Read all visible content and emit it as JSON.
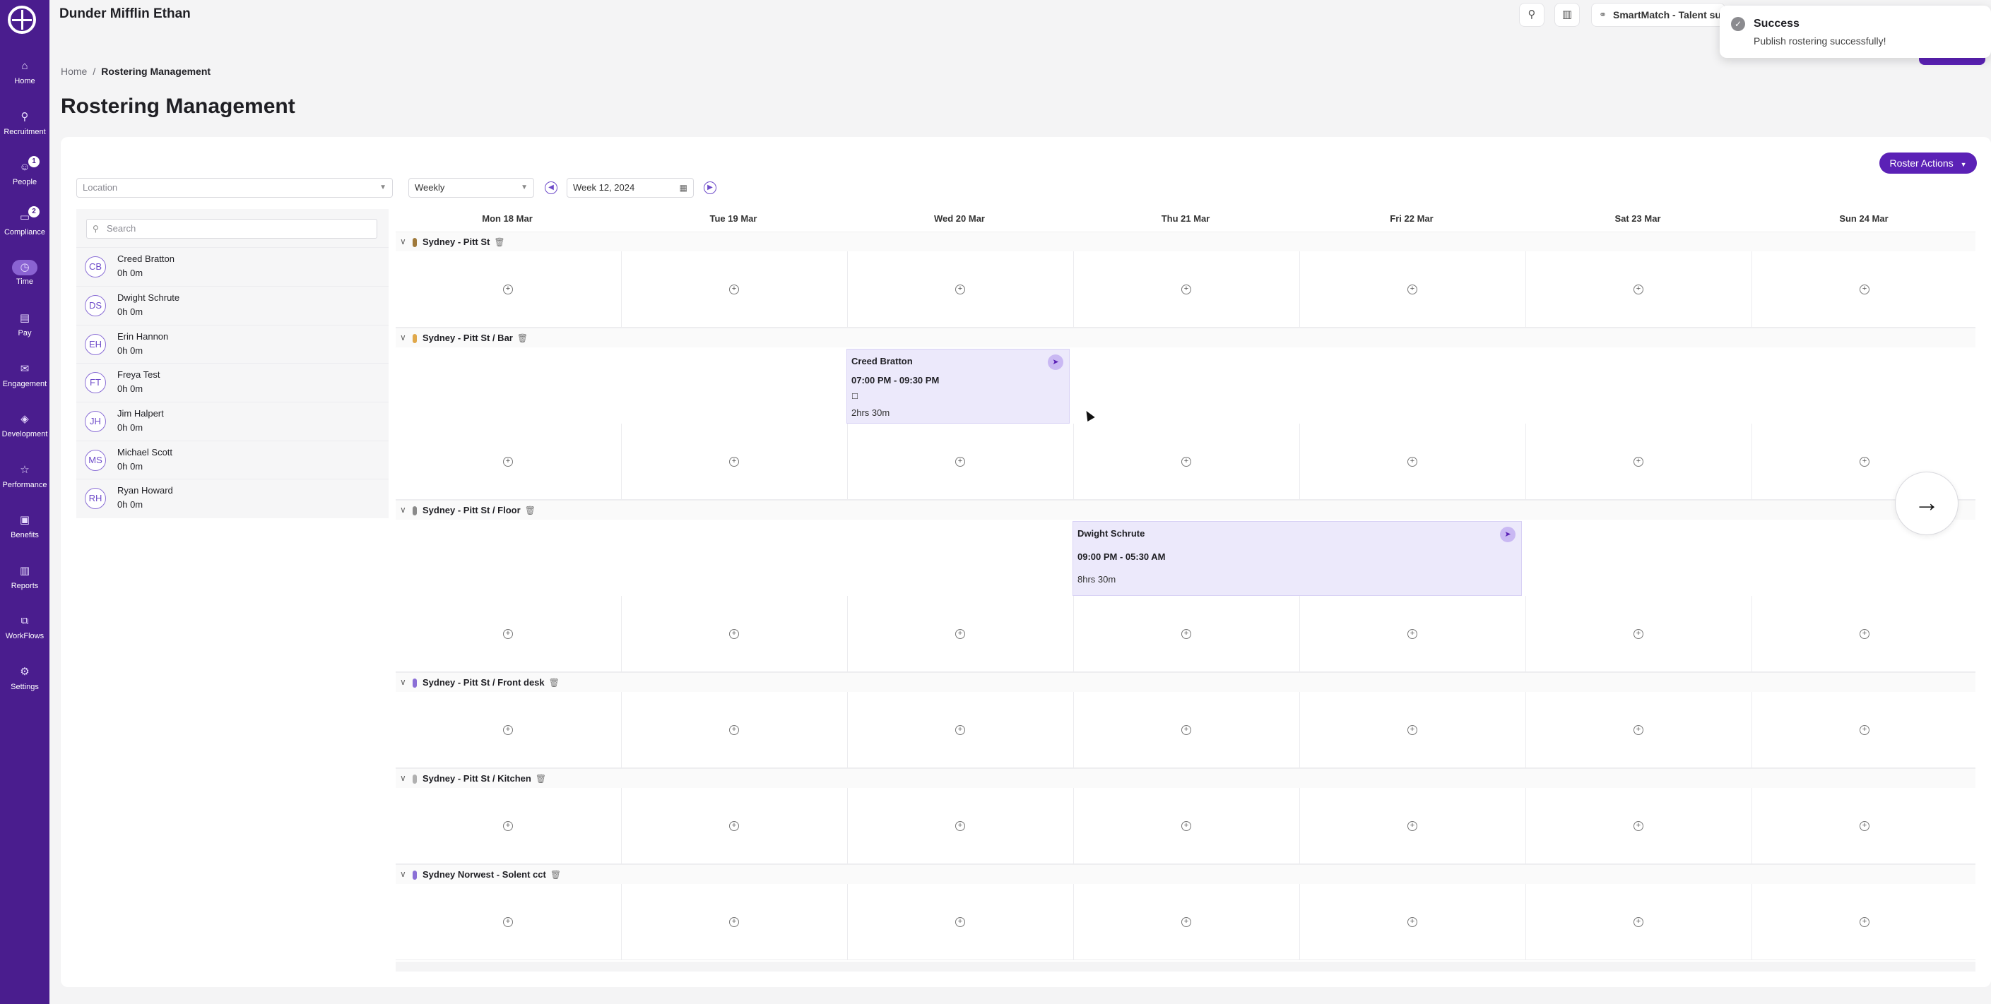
{
  "org": {
    "name": "Dunder Mifflin Ethan"
  },
  "sidebar": {
    "items": [
      {
        "label": "Home",
        "icon": "home-icon"
      },
      {
        "label": "Recruitment",
        "icon": "search-icon"
      },
      {
        "label": "People",
        "icon": "people-icon",
        "badge": "1"
      },
      {
        "label": "Compliance",
        "icon": "compliance-icon",
        "badge": "2"
      },
      {
        "label": "Time",
        "icon": "clock-icon"
      },
      {
        "label": "Pay",
        "icon": "pay-icon"
      },
      {
        "label": "Engagement",
        "icon": "chat-icon"
      },
      {
        "label": "Development",
        "icon": "graduation-icon"
      },
      {
        "label": "Performance",
        "icon": "star-icon"
      },
      {
        "label": "Benefits",
        "icon": "gift-icon"
      },
      {
        "label": "Reports",
        "icon": "chart-icon"
      },
      {
        "label": "WorkFlows",
        "icon": "workflow-icon"
      },
      {
        "label": "Settings",
        "icon": "gear-icon"
      }
    ]
  },
  "topbar": {
    "smartmatch_label": "SmartMatch - Talent su"
  },
  "toast": {
    "title": "Success",
    "message": "Publish rostering successfully!"
  },
  "breadcrumb": {
    "home": "Home",
    "current": "Rostering Management"
  },
  "page": {
    "title": "Rostering Management"
  },
  "controls": {
    "roster_actions": "Roster Actions",
    "location_placeholder": "Location",
    "view_mode": "Weekly",
    "week": "Week 12, 2024"
  },
  "staff": {
    "search_placeholder": "Search",
    "members": [
      {
        "initials": "CB",
        "name": "Creed Bratton",
        "hours": "0h 0m"
      },
      {
        "initials": "DS",
        "name": "Dwight Schrute",
        "hours": "0h 0m"
      },
      {
        "initials": "EH",
        "name": "Erin Hannon",
        "hours": "0h 0m"
      },
      {
        "initials": "FT",
        "name": "Freya Test",
        "hours": "0h 0m"
      },
      {
        "initials": "JH",
        "name": "Jim Halpert",
        "hours": "0h 0m"
      },
      {
        "initials": "MS",
        "name": "Michael Scott",
        "hours": "0h 0m"
      },
      {
        "initials": "RH",
        "name": "Ryan Howard",
        "hours": "0h 0m"
      }
    ]
  },
  "days": [
    "Mon 18 Mar",
    "Tue 19 Mar",
    "Wed 20 Mar",
    "Thu 21 Mar",
    "Fri 22 Mar",
    "Sat 23 Mar",
    "Sun 24 Mar"
  ],
  "sections": [
    {
      "name": "Sydney - Pitt St",
      "color": "#a07a3c"
    },
    {
      "name": "Sydney - Pitt St / Bar",
      "color": "#e0a84a"
    },
    {
      "name": "Sydney - Pitt St / Floor",
      "color": "#8a8a8a"
    },
    {
      "name": "Sydney - Pitt St / Front desk",
      "color": "#8b6fd6"
    },
    {
      "name": "Sydney - Pitt St / Kitchen",
      "color": "#b0b0b0"
    },
    {
      "name": "Sydney Norwest - Solent cct",
      "color": "#8b6fd6"
    }
  ],
  "shifts": [
    {
      "name": "Creed Bratton",
      "time": "07:00 PM - 09:30 PM",
      "duration": "2hrs 30m",
      "note_icon": "note-icon"
    },
    {
      "name": "Dwight Schrute",
      "time": "09:00 PM - 05:30 AM",
      "duration": "8hrs 30m"
    }
  ],
  "colors": {
    "sidebar": "#4a1d8e",
    "accent": "#5b21b6",
    "shift_bg": "#ece9fb"
  }
}
